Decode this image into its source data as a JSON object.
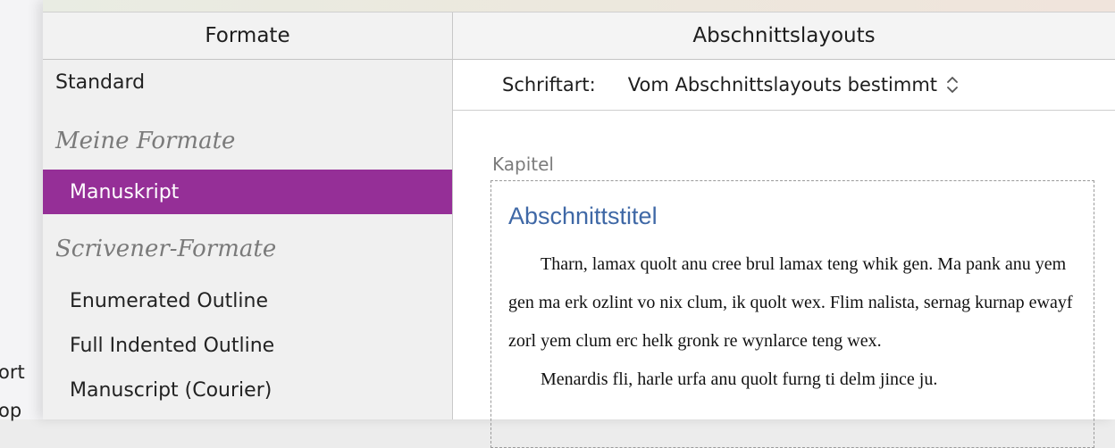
{
  "background_window": {
    "fragments": [
      "ort",
      "op"
    ]
  },
  "formats_pane": {
    "header": "Formate",
    "standard_item": "Standard",
    "my_formats_group": "Meine Formate",
    "my_formats": [
      {
        "label": "Manuskript",
        "selected": true
      }
    ],
    "scrivener_group": "Scrivener-Formate",
    "scrivener_formats": [
      {
        "label": "Enumerated Outline"
      },
      {
        "label": "Full Indented Outline"
      },
      {
        "label": "Manuscript (Courier)"
      }
    ],
    "selection_color": "#952f97"
  },
  "layouts_pane": {
    "header": "Abschnittslayouts",
    "font_label": "Schriftart:",
    "font_value": "Vom Abschnittslayouts bestimmt",
    "section_type": "Kapitel",
    "preview": {
      "title": "Abschnittstitel",
      "title_color": "#3f68a6",
      "paragraphs": [
        "Tharn, lamax quolt anu cree brul lamax teng whik gen. Ma pank anu yem gen ma erk ozlint vo nix clum, ik quolt wex. Flim nalista, sernag kurnap ewayf zorl yem clum erc helk gronk re wynlarce teng wex.",
        "Menardis fli, harle urfa anu quolt furng ti delm jince ju."
      ]
    }
  }
}
